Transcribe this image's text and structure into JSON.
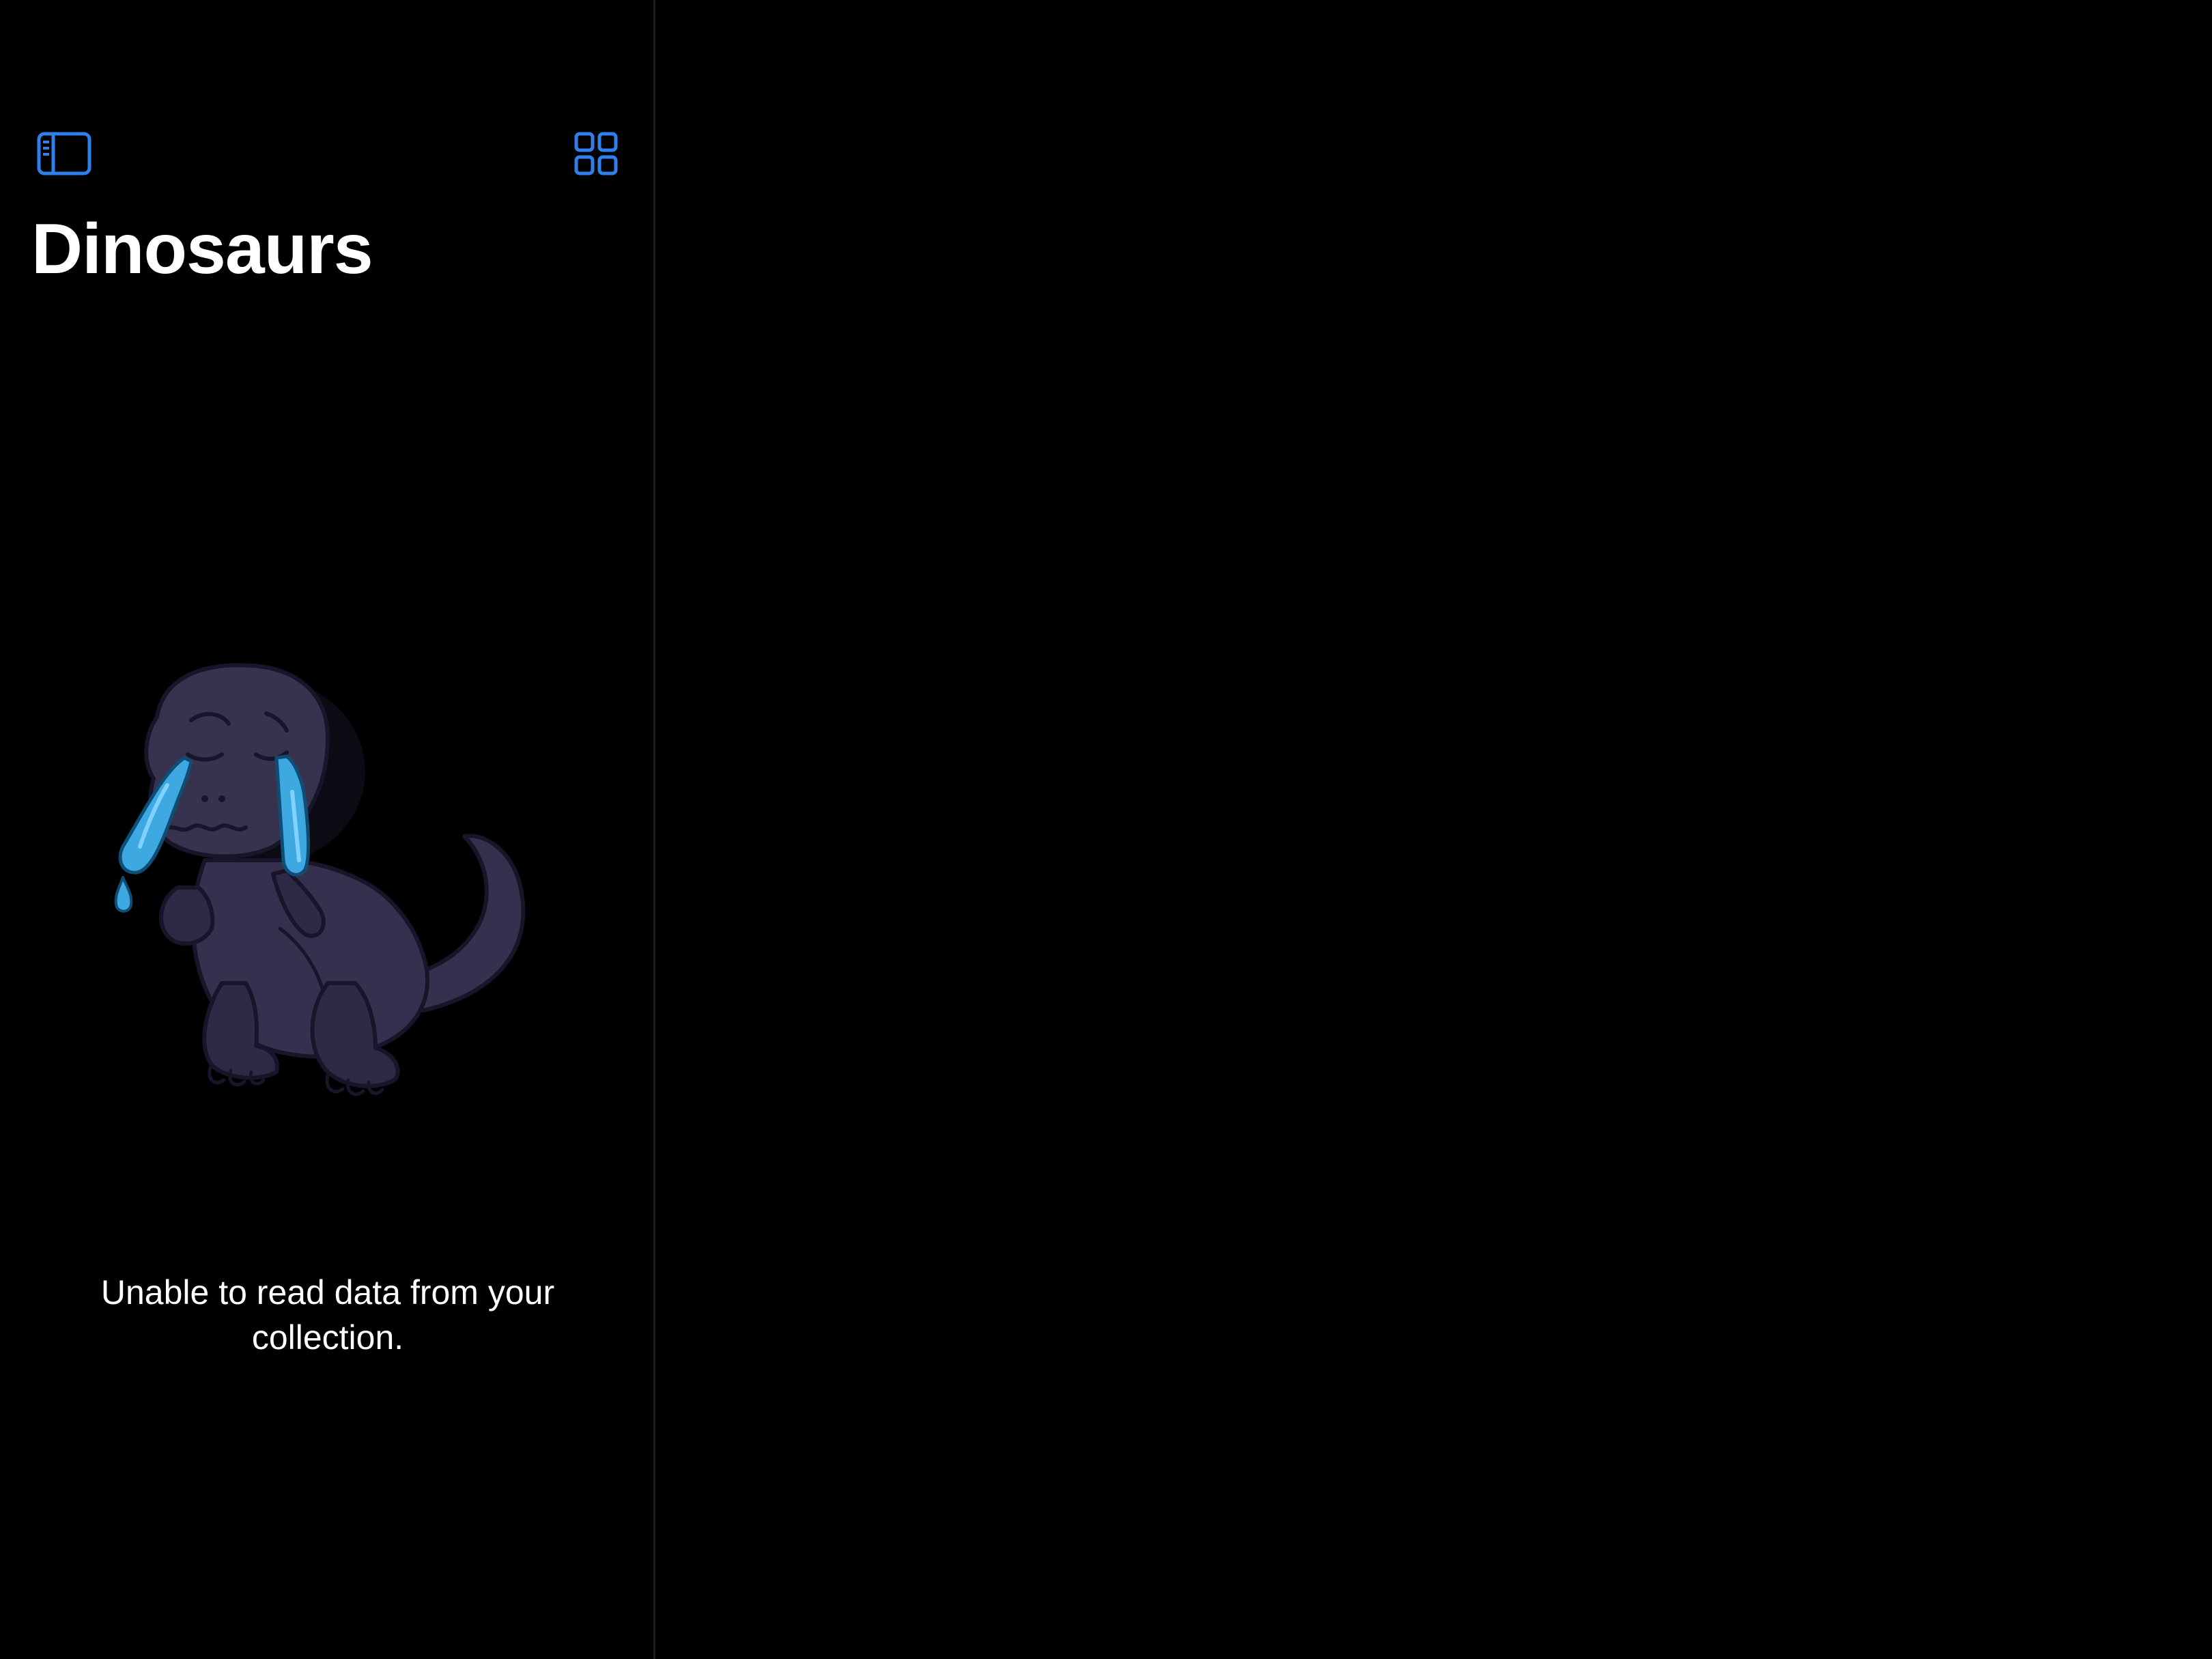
{
  "sidebar": {
    "title": "Dinosaurs",
    "toolbar": {
      "left_icon": "sidebar-left-icon",
      "right_icon": "square-grid-icon",
      "accent_color": "#2f80ed"
    },
    "empty_state": {
      "illustration": "crying-dinosaur",
      "message": "Unable to read data from your collection."
    }
  },
  "detail": {}
}
